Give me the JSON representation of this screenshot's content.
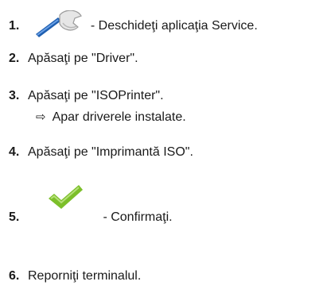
{
  "steps": [
    {
      "number": "1.",
      "text": " - Deschideţi aplicaţia Service.",
      "icon": "wrench-icon"
    },
    {
      "number": "2.",
      "text": "Apăsaţi pe \"Driver\"."
    },
    {
      "number": "3.",
      "text": "Apăsaţi pe \"ISOPrinter\".",
      "result_arrow": "⇨",
      "result": "Apar driverele instalate."
    },
    {
      "number": "4.",
      "text": "Apăsaţi pe \"Imprimantă ISO\"."
    },
    {
      "number": "5.",
      "text": " - Confirmaţi.",
      "icon": "checkmark-icon"
    },
    {
      "number": "6.",
      "text": "Reporniţi terminalul."
    }
  ],
  "colors": {
    "wrench_blue": "#1f5fb0",
    "wrench_light": "#e6e6e6",
    "check_green": "#7cbf2a"
  }
}
